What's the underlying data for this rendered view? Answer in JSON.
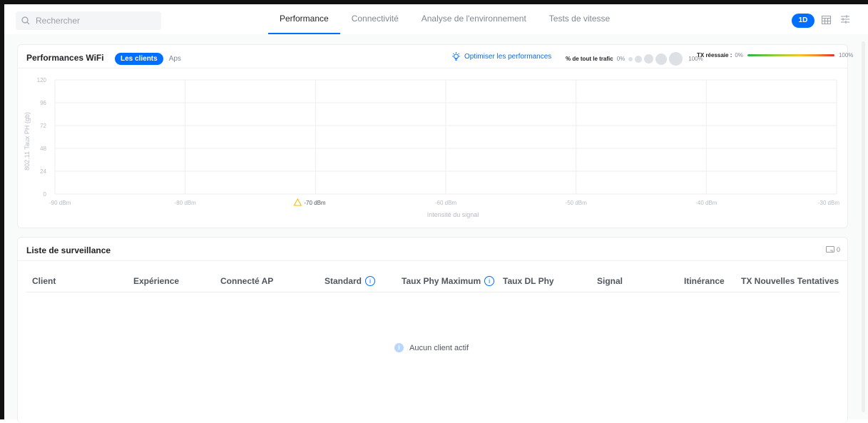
{
  "search": {
    "placeholder": "Rechercher"
  },
  "tabs": [
    {
      "label": "Performance",
      "active": true
    },
    {
      "label": "Connectivité",
      "active": false
    },
    {
      "label": "Analyse de l'environnement",
      "active": false
    },
    {
      "label": "Tests de vitesse",
      "active": false
    }
  ],
  "header_right": {
    "range_label": "1D",
    "icons": [
      "calendar-icon",
      "filter-icon"
    ]
  },
  "colors": {
    "accent": "#006fff",
    "warning": "#f7b500",
    "tx_gradient": [
      "#2bb24c",
      "#f7c32b",
      "#e62e2e"
    ]
  },
  "wifi_card": {
    "title": "Performances WiFi",
    "segments": [
      {
        "label": "Les clients",
        "active": true
      },
      {
        "label": "Aps",
        "active": false
      }
    ],
    "optimize_label": "Optimiser les performances",
    "traffic_legend": {
      "label": "% de tout le trafic",
      "min": "0%",
      "max": "100%"
    },
    "tx_legend": {
      "label": "TX réessaie : ",
      "min": "0%",
      "max": "100%"
    }
  },
  "chart_data": {
    "type": "scatter",
    "title": "",
    "xlabel": "Intensité du signal",
    "ylabel": "802.11 Taux PH (gb)",
    "x_ticks": [
      "-90 dBm",
      "-80 dBm",
      "-70 dBm",
      "-60 dBm",
      "-50 dBm",
      "-40 dBm",
      "-30 dBm"
    ],
    "x_tick_values": [
      -90,
      -80,
      -70,
      -60,
      -50,
      -40,
      -30
    ],
    "y_ticks": [
      "120",
      "96",
      "72",
      "48",
      "24",
      "0"
    ],
    "xlim": [
      -90,
      -30
    ],
    "ylim": [
      0,
      120
    ],
    "warning_tick": "-70 dBm",
    "grid": true,
    "series": []
  },
  "watchlist": {
    "title": "Liste de surveillance",
    "count": "0",
    "columns": [
      {
        "label": "Client",
        "info": false
      },
      {
        "label": "Expérience",
        "info": false
      },
      {
        "label": "Connecté AP",
        "info": false
      },
      {
        "label": "Standard",
        "info": true
      },
      {
        "label": "Taux Phy Maximum",
        "info": true
      },
      {
        "label": "Taux DL Phy",
        "info": false
      },
      {
        "label": "Signal",
        "info": false
      },
      {
        "label": "Itinérance",
        "info": false
      },
      {
        "label": "TX Nouvelles Tentatives",
        "info": false
      }
    ],
    "empty_message": "Aucun client actif"
  }
}
